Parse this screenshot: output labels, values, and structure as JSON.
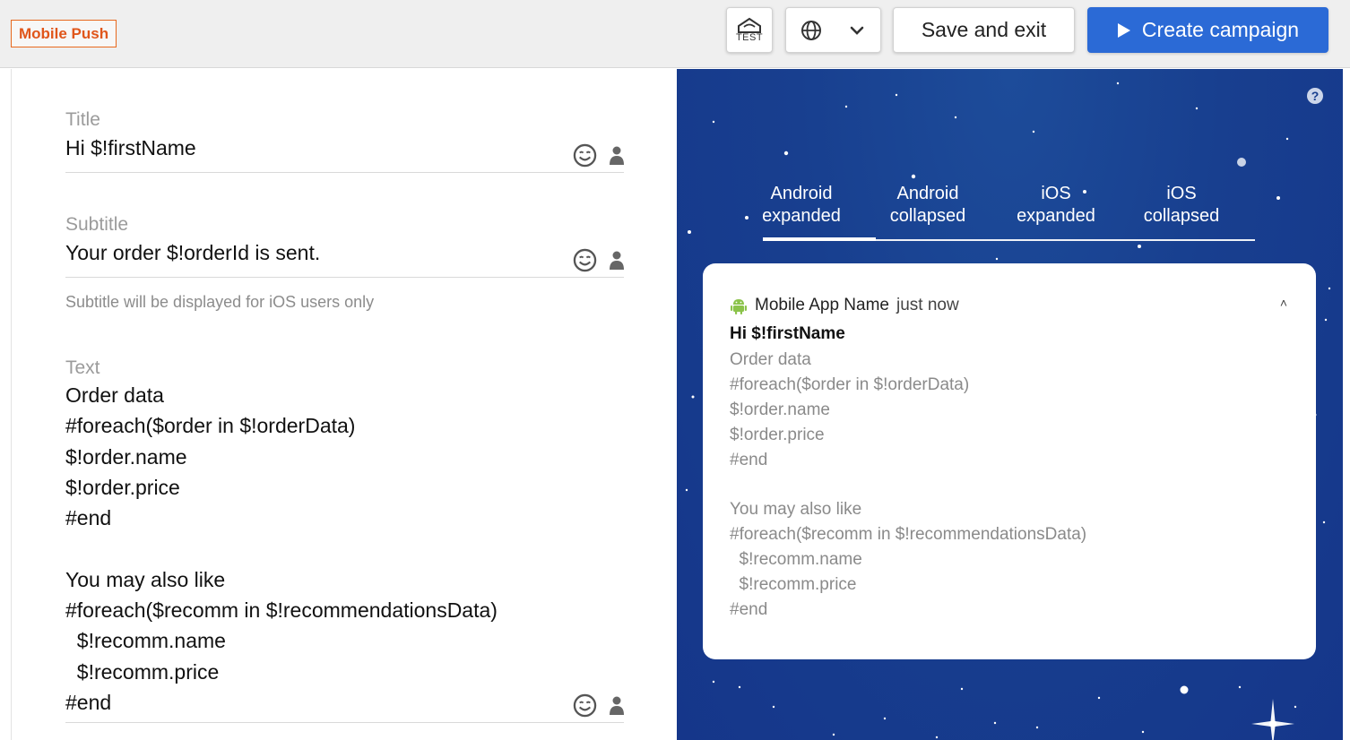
{
  "header": {
    "badge": "Mobile Push",
    "test_label": "TEST",
    "save_label": "Save and exit",
    "create_label": "Create campaign"
  },
  "editor": {
    "title": {
      "label": "Title",
      "value": "Hi $!firstName"
    },
    "subtitle": {
      "label": "Subtitle",
      "value": "Your order $!orderId is sent.",
      "hint": "Subtitle will be displayed for iOS users only"
    },
    "text": {
      "label": "Text",
      "value": "Order data\n#foreach($order in $!orderData)\n$!order.name\n$!order.price\n#end\n\nYou may also like\n#foreach($recomm in $!recommendationsData)\n  $!recomm.name\n  $!recomm.price\n#end"
    }
  },
  "preview": {
    "help": "?",
    "tabs": [
      {
        "label": "Android\nexpanded",
        "active": true
      },
      {
        "label": "Android\ncollapsed",
        "active": false
      },
      {
        "label": "iOS\nexpanded",
        "active": false
      },
      {
        "label": "iOS\ncollapsed",
        "active": false
      }
    ],
    "card": {
      "app_name": "Mobile App Name",
      "time": "just now",
      "chevron": "˄",
      "title": "Hi $!firstName",
      "body": "Order data\n#foreach($order in $!orderData)\n$!order.name\n$!order.price\n#end\n\nYou may also like\n#foreach($recomm in $!recommendationsData)\n  $!recomm.name\n  $!recomm.price\n#end"
    }
  },
  "colors": {
    "accent": "#2b6ad6",
    "badge": "#e0561a",
    "android": "#8bc34a",
    "preview_bg": "#183f8f"
  },
  "icons": {
    "test": "test-icon",
    "globe": "globe-icon",
    "chevron": "chevron-down-icon",
    "play": "play-icon",
    "emoji": "emoji-icon",
    "person": "person-icon",
    "android": "android-icon",
    "help": "help-icon"
  }
}
